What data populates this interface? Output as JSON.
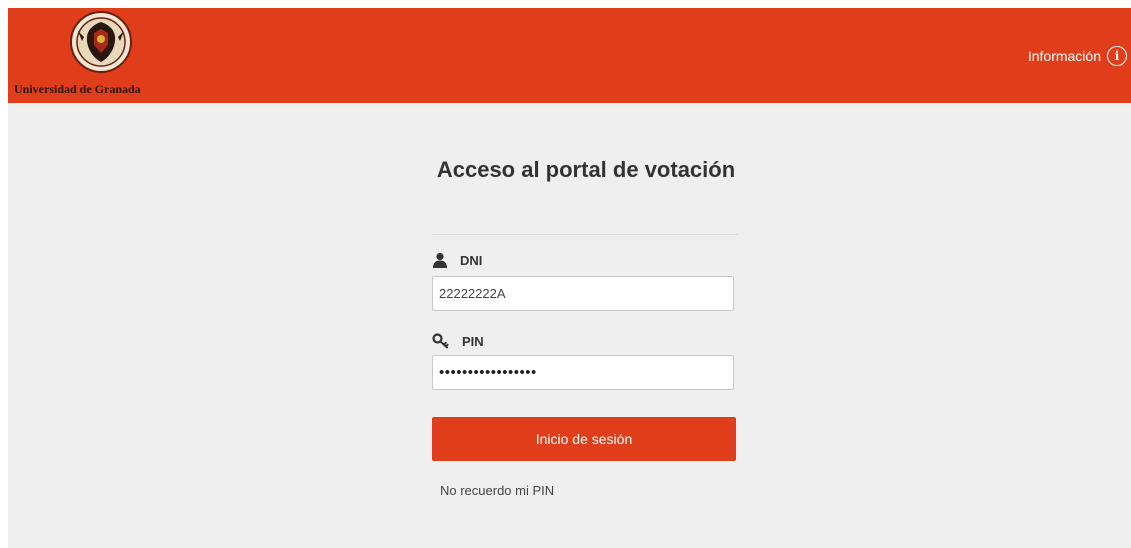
{
  "header": {
    "logo_text": "Universidad de Granada",
    "info_label": "Información",
    "info_icon": "info-circle-icon",
    "background_color": "#e03e1a"
  },
  "login": {
    "title": "Acceso al portal de votación",
    "dni": {
      "label": "DNI",
      "icon": "user-icon",
      "value": "22222222A"
    },
    "pin": {
      "label": "PIN",
      "icon": "key-icon",
      "value": "•••••••••••••••••"
    },
    "submit_label": "Inicio de sesión",
    "forgot_label": "No recuerdo mi PIN",
    "button_color": "#e03e1a"
  }
}
